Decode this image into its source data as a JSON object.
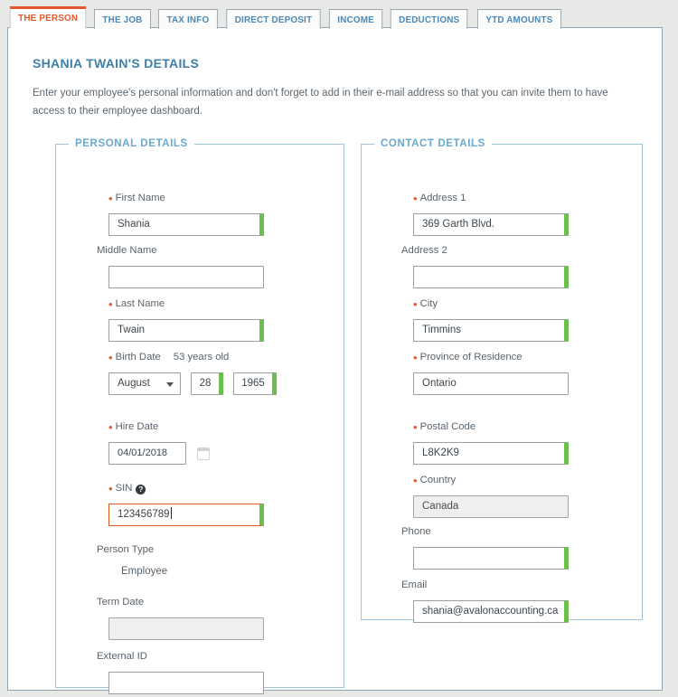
{
  "tabs": [
    {
      "label": "THE PERSON",
      "active": true
    },
    {
      "label": "THE JOB",
      "active": false
    },
    {
      "label": "TAX INFO",
      "active": false
    },
    {
      "label": "DIRECT DEPOSIT",
      "active": false
    },
    {
      "label": "INCOME",
      "active": false
    },
    {
      "label": "DEDUCTIONS",
      "active": false
    },
    {
      "label": "YTD AMOUNTS",
      "active": false
    }
  ],
  "page": {
    "title": "SHANIA TWAIN'S DETAILS",
    "description": "Enter your employee's personal information and don't forget to add in their e-mail address so that you can invite them to have access to their employee dashboard."
  },
  "personal_details": {
    "legend": "PERSONAL DETAILS",
    "first_name": {
      "label": "First Name",
      "value": "Shania"
    },
    "middle_name": {
      "label": "Middle Name",
      "value": ""
    },
    "last_name": {
      "label": "Last Name",
      "value": "Twain"
    },
    "birth_date": {
      "label": "Birth Date",
      "age_note": "53 years old",
      "month": "August",
      "day": "28",
      "year": "1965"
    },
    "hire_date": {
      "label": "Hire Date",
      "value": "04/01/2018",
      "icon": "calendar-icon"
    },
    "sin": {
      "label": "SIN",
      "value": "123456789",
      "help_icon": "help-circle-icon",
      "help_glyph": "?"
    },
    "person_type": {
      "label": "Person Type",
      "value": "Employee"
    },
    "term_date": {
      "label": "Term Date",
      "value": ""
    },
    "external_id": {
      "label": "External ID",
      "value": ""
    }
  },
  "contact_details": {
    "legend": "CONTACT DETAILS",
    "address1": {
      "label": "Address 1",
      "value": "369 Garth Blvd."
    },
    "address2": {
      "label": "Address 2",
      "value": ""
    },
    "city": {
      "label": "City",
      "value": "Timmins"
    },
    "province": {
      "label": "Province of Residence",
      "value": "Ontario"
    },
    "postal_code": {
      "label": "Postal Code",
      "value": "L8K2K9"
    },
    "country": {
      "label": "Country",
      "value": "Canada"
    },
    "phone": {
      "label": "Phone",
      "value": ""
    },
    "email": {
      "label": "Email",
      "value": "shania@avalonaccounting.ca"
    }
  },
  "colors": {
    "accent_orange": "#e2572a",
    "heading_blue": "#3d7fa8",
    "legend_blue": "#6aa9cd",
    "tab_blue": "#4a89b8",
    "valid_green": "#6cbf4b",
    "page_bg": "#e8e8e6"
  },
  "markers": {
    "required": "•"
  }
}
